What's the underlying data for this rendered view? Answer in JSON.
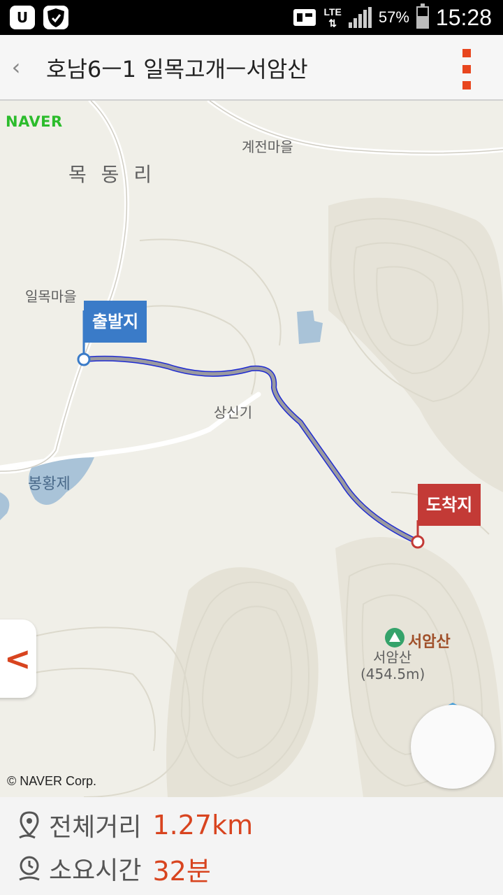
{
  "status_bar": {
    "network": "LTE",
    "battery_percent": "57%",
    "battery_level": 0.57,
    "time": "15:28",
    "left_icons": [
      "u-plus-icon",
      "shield-icon"
    ]
  },
  "header": {
    "back_icon": "back-chevron-icon",
    "title": "호남6ㅡ1 일목고개ㅡ서암산",
    "menu_icon": "overflow-menu-icon"
  },
  "map": {
    "logo": "NAVER",
    "copyright": "© NAVER Corp.",
    "labels": {
      "mokdong": "목 동 리",
      "gyejeon": "계전마을",
      "ilmok": "일목마을",
      "sangsingi": "상신기",
      "bonghwang": "봉황제",
      "summit_name": "서암산",
      "summit_label": "서암산",
      "summit_elev": "(454.5m)"
    },
    "start_flag": "출발지",
    "end_flag": "도착지",
    "colors": {
      "route": "#1f2bd1",
      "start": "#3a7bc8",
      "end": "#c33a36",
      "accent": "#d8441f"
    }
  },
  "footer": {
    "distance_label": "전체거리",
    "distance_value": "1.27km",
    "time_label": "소요시간",
    "time_value": "32분"
  }
}
